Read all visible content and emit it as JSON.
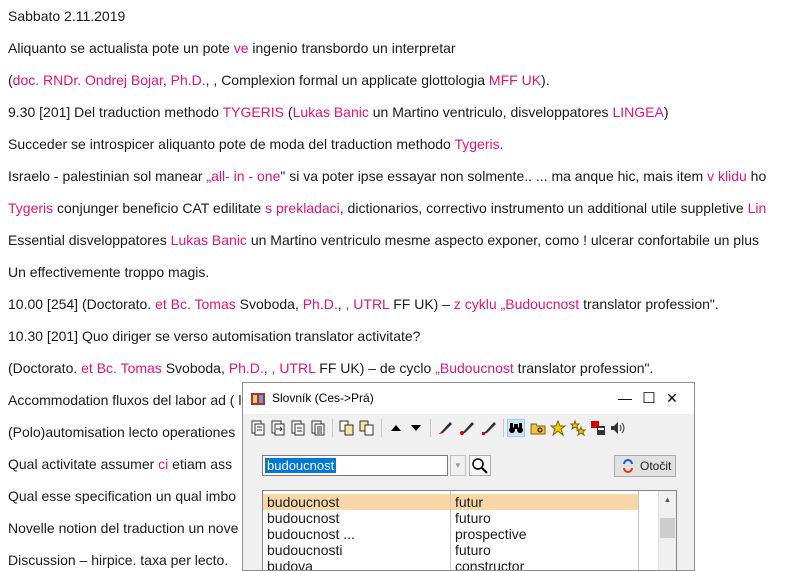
{
  "document": {
    "lines": [
      [
        {
          "t": "Sabbato 2.11.2019"
        }
      ],
      [
        {
          "t": "Aliquanto se actualista pote un pote "
        },
        {
          "t": "ve",
          "h": 1
        },
        {
          "t": " ingenio transbordo un interpretar"
        }
      ],
      [
        {
          "t": "("
        },
        {
          "t": "doc. RNDr. Ondrej Bojar",
          "h": 1
        },
        {
          "t": ", "
        },
        {
          "t": "Ph.D.",
          "h": 1
        },
        {
          "t": ", , Complexion formal un applicate glottologia "
        },
        {
          "t": "MFF UK",
          "h": 1
        },
        {
          "t": ")."
        }
      ],
      [
        {
          "t": "9.30 [201] Del traduction methodo "
        },
        {
          "t": "TYGERIS",
          "h": 1
        },
        {
          "t": " ("
        },
        {
          "t": "Lukas Banic",
          "h": 1
        },
        {
          "t": " un Martino ventriculo, disveloppatores "
        },
        {
          "t": "LINGEA",
          "h": 1
        },
        {
          "t": ")"
        }
      ],
      [
        {
          "t": "Succeder se introspicer aliquanto pote de moda del traduction methodo "
        },
        {
          "t": "Tygeris",
          "h": 1
        },
        {
          "t": "."
        }
      ],
      [
        {
          "t": "Israelo - palestinian sol manear "
        },
        {
          "t": "„all- in - one",
          "h": 1
        },
        {
          "t": "\" si va poter ipse essayar non solmente.. ... ma anque hic, mais item "
        },
        {
          "t": "v klidu",
          "h": 1
        },
        {
          "t": " ho"
        }
      ],
      [
        {
          "t": "Tygeris",
          "h": 1
        },
        {
          "t": " conjunger beneficio CAT edilitate "
        },
        {
          "t": "s prekladaci",
          "h": 1
        },
        {
          "t": ", dictionarios, correctivo instrumento un additional utile suppletive "
        },
        {
          "t": "Lin",
          "h": 1
        }
      ],
      [
        {
          "t": "Essential disveloppatores "
        },
        {
          "t": "Lukas Banic",
          "h": 1
        },
        {
          "t": " un Martino ventriculo mesme aspecto exponer, como ! ulcerar confortabile un plus"
        }
      ],
      [
        {
          "t": "Un effectivemente troppo magis."
        }
      ],
      [
        {
          "t": "10.00 [254] (Doctorato. "
        },
        {
          "t": "et Bc. Tomas",
          "h": 1
        },
        {
          "t": " Svoboda, "
        },
        {
          "t": "Ph.D.",
          "h": 1
        },
        {
          "t": ", "
        },
        {
          "t": ", UTRL",
          "h": 1
        },
        {
          "t": " FF UK) – "
        },
        {
          "t": "z cyklu „Budoucnost",
          "h": 1
        },
        {
          "t": " translator profession\"."
        }
      ],
      [
        {
          "t": "10.30 [201] Quo diriger se verso automisation translator activitate?"
        }
      ],
      [
        {
          "t": "(Doctorato. "
        },
        {
          "t": "et Bc. Tomas",
          "h": 1
        },
        {
          "t": " Svoboda, "
        },
        {
          "t": "Ph.D.",
          "h": 1
        },
        {
          "t": ", "
        },
        {
          "t": ", UTRL",
          "h": 1
        },
        {
          "t": " FF UK) – de cyclo "
        },
        {
          "t": "„Budoucnost",
          "h": 1
        },
        {
          "t": " translator profession\"."
        }
      ],
      [
        {
          "t": "Accommodation fluxos del labor ad ("
        },
        {
          "t": "",
          "h": 0
        },
        {
          "t": "                                                                          l traduction a pa"
        }
      ],
      [
        {
          "t": "(Polo)automisation lecto operationes"
        }
      ],
      [
        {
          "t": "Qual activitate assumer "
        },
        {
          "t": "ci",
          "h": 1
        },
        {
          "t": " etiam ass"
        }
      ],
      [
        {
          "t": "Qual esse specification un qual imbo"
        }
      ],
      [
        {
          "t": "Novelle notion del traduction un nove"
        }
      ],
      [
        {
          "t": "Discussion – hirpice. taxa per lecto."
        }
      ]
    ]
  },
  "dictionary": {
    "title": "Slovník (Ces->Prá)",
    "controls": {
      "minimize": "—",
      "maximize": "☐",
      "close": "✕"
    },
    "search": {
      "value": "budoucnost"
    },
    "swap_label": "Otočit",
    "results": [
      {
        "term": "budoucnost",
        "translation": "futur",
        "selected": true
      },
      {
        "term": "budoucnost",
        "translation": "futuro",
        "selected": false
      },
      {
        "term": "budoucnost ...",
        "translation": "prospective",
        "selected": false
      },
      {
        "term": "budoucnosti",
        "translation": "futuro",
        "selected": false
      },
      {
        "term": "budova",
        "translation": "constructor",
        "selected": false
      }
    ],
    "toolbar_icons": [
      "copy-icon",
      "paste-icon",
      "copy-all-icon",
      "export-icon",
      "clipboard-copy-icon",
      "clipboard-paste-icon",
      "arrow-up-icon",
      "arrow-down-icon",
      "pen-red-icon",
      "pen-marker-icon",
      "pen-insert-icon",
      "binoculars-icon",
      "folder-search-icon",
      "star-icon",
      "stars-icon",
      "settings-icon",
      "speaker-icon"
    ]
  }
}
